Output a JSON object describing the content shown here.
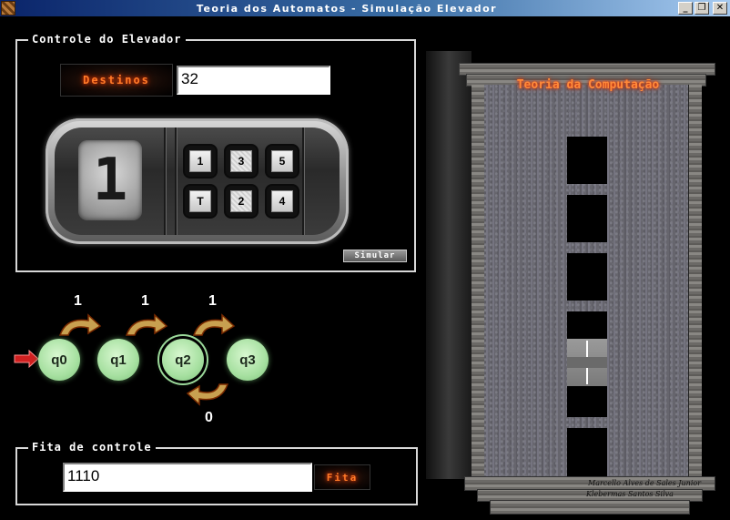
{
  "window": {
    "title": "Teoria dos Automatos - Simulação Elevador",
    "minimize_glyph": "_",
    "restore_glyph": "❐",
    "close_glyph": "✕"
  },
  "controle": {
    "group_title": "Controle do Elevador",
    "destinos_label": "Destinos",
    "destinos_value": "32",
    "display_digit": "1",
    "keys": [
      "1",
      "3",
      "5",
      "T",
      "2",
      "4"
    ],
    "pressed_keys": [
      "3",
      "2"
    ],
    "simular_label": "Simular"
  },
  "automaton": {
    "states": [
      "q0",
      "q1",
      "q2",
      "q3"
    ],
    "current_state": "q2",
    "transitions": [
      {
        "label": "1"
      },
      {
        "label": "1"
      },
      {
        "label": "1"
      },
      {
        "label": "0"
      }
    ]
  },
  "fita": {
    "group_title": "Fita de controle",
    "value": "1110",
    "button_label": "Fita"
  },
  "building": {
    "sign": "Teoria da Computação",
    "credits_line1": "Marcello Alves de Sales Junior",
    "credits_line2": "Klebermas Santos Silva"
  },
  "colors": {
    "title_bar": "#0a246a",
    "fire_text": "#ff7a28",
    "state_fill": "#a6e0a0"
  }
}
